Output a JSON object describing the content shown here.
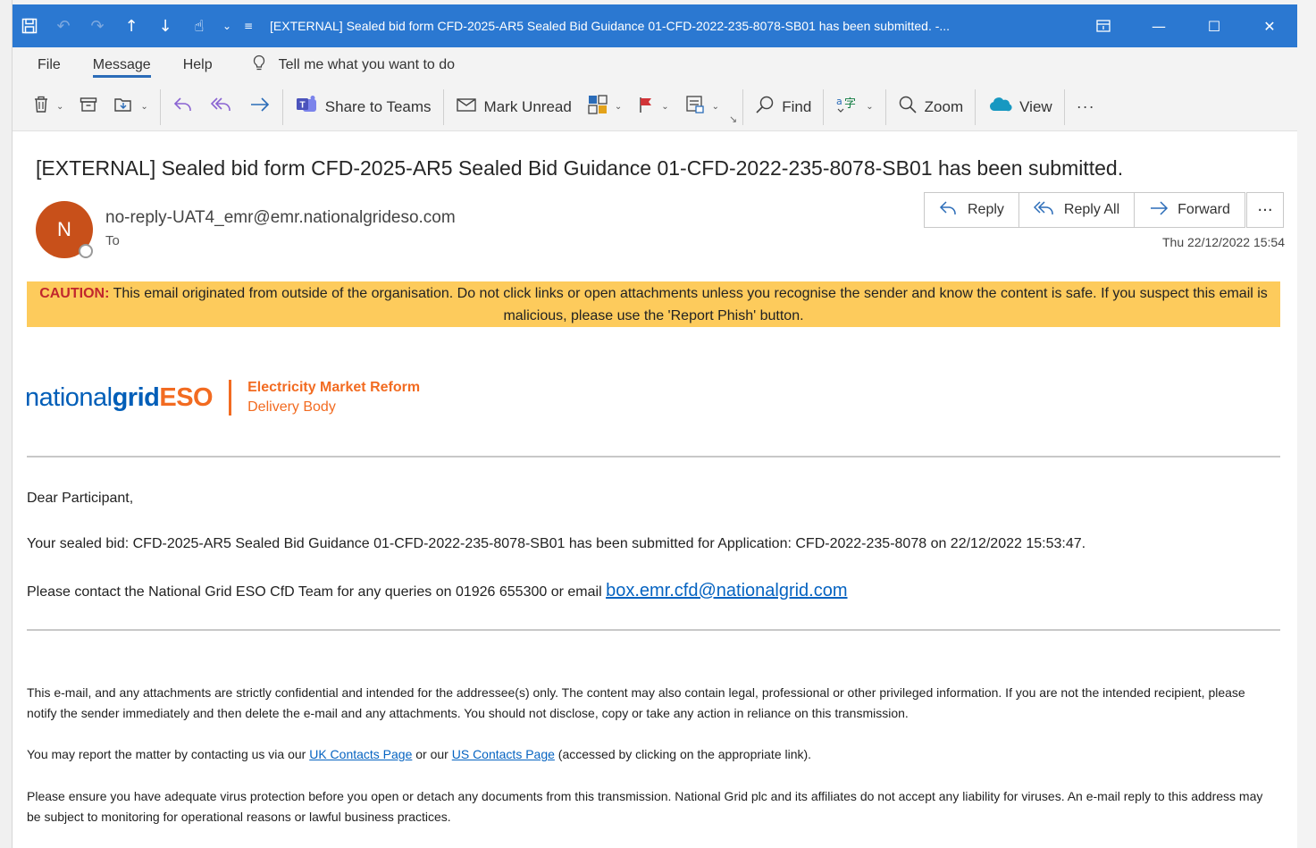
{
  "titlebar": {
    "title": "[EXTERNAL] Sealed bid form CFD-2025-AR5 Sealed Bid Guidance 01-CFD-2022-235-8078-SB01 has been submitted. -..."
  },
  "menu": {
    "file": "File",
    "message": "Message",
    "help": "Help",
    "tell_me": "Tell me what you want to do"
  },
  "ribbon": {
    "share_teams": "Share to Teams",
    "mark_unread": "Mark Unread",
    "find": "Find",
    "zoom": "Zoom",
    "view": "View"
  },
  "email": {
    "subject": "[EXTERNAL] Sealed bid form CFD-2025-AR5 Sealed Bid Guidance 01-CFD-2022-235-8078-SB01 has been submitted.",
    "avatar_initial": "N",
    "sender": "no-reply-UAT4_emr@emr.nationalgrideso.com",
    "to_label": "To",
    "date": "Thu 22/12/2022 15:54",
    "reply": "Reply",
    "reply_all": "Reply All",
    "forward": "Forward",
    "more": "···"
  },
  "caution": {
    "label": "CAUTION:",
    "text": " This email originated from outside of the organisation. Do not click links or open attachments unless you recognise the sender and know the content is safe. If you suspect this email is malicious, please use the 'Report Phish' button."
  },
  "logo": {
    "national": "national",
    "grid": "grid",
    "eso": "ESO",
    "line1": "Electricity Market Reform",
    "line2": "Delivery Body"
  },
  "body": {
    "greeting": "Dear Participant,",
    "bid_line": "Your sealed bid: CFD-2025-AR5 Sealed Bid Guidance 01-CFD-2022-235-8078-SB01 has been submitted for Application: CFD-2022-235-8078 on 22/12/2022 15:53:47.",
    "contact_prefix": "Please contact the National Grid ESO CfD Team for any queries on 01926 655300 or email ",
    "contact_email": "box.emr.cfd@nationalgrid.com"
  },
  "footer": {
    "confidential": "This e-mail, and any attachments are strictly confidential and intended for the addressee(s) only. The content may also contain legal, professional or other privileged information. If you are not the intended recipient, please notify the sender immediately and then delete the e-mail and any attachments. You should not disclose, copy or take any action in reliance on this transmission.",
    "report_prefix": "You may report the matter by contacting us via our ",
    "uk_link": "UK Contacts Page",
    "report_mid": " or our ",
    "us_link": "US Contacts Page",
    "report_suffix": " (accessed by clicking on the appropriate link).",
    "virus": "Please ensure you have adequate virus protection before you open or detach any documents from this transmission. National Grid plc and its affiliates do not accept any liability for viruses. An e-mail reply to this address may be subject to monitoring for operational reasons or lawful business practices."
  },
  "colors": {
    "titlebar": "#2b78d1",
    "caution_bg": "#fdcb5c",
    "avatar_bg": "#c8501a",
    "link": "#0563c1",
    "brand_blue": "#005eb8",
    "brand_orange": "#f26b21"
  }
}
